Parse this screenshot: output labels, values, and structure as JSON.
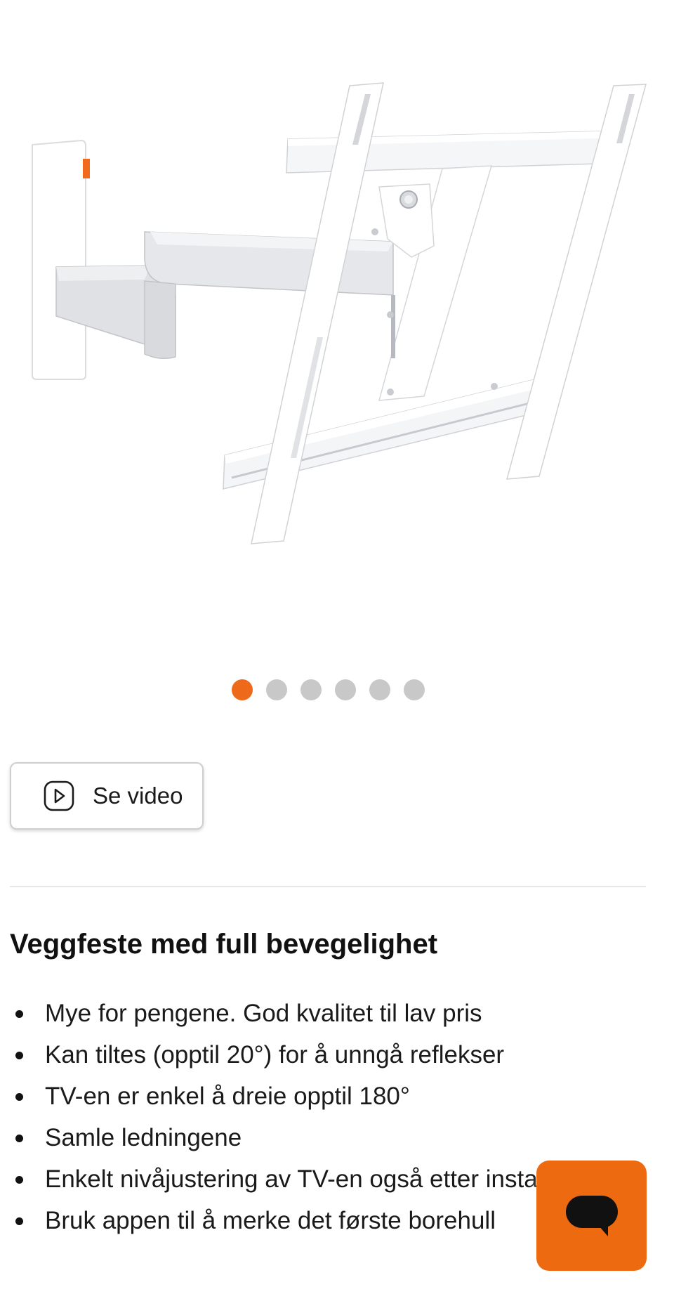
{
  "carousel": {
    "slide_count": 6,
    "active_index": 0,
    "active_color": "#ee6a1a",
    "inactive_color": "#c8c8c8"
  },
  "video_button": {
    "label": "Se video",
    "icon": "play-icon"
  },
  "product": {
    "title": "Veggfeste med full bevegelighet",
    "features": [
      "Mye for pengene. God kvalitet til lav pris",
      "Kan tiltes (opptil 20°) for å unngå reflekser",
      "TV-en er enkel å dreie opptil 180°",
      "Samle ledningene",
      "Enkelt nivåjustering av TV-en også etter installasjon",
      "Bruk appen til å merke det første borehull"
    ]
  },
  "chat_button": {
    "icon": "chat-bubble-icon",
    "color": "#ee6a10"
  }
}
